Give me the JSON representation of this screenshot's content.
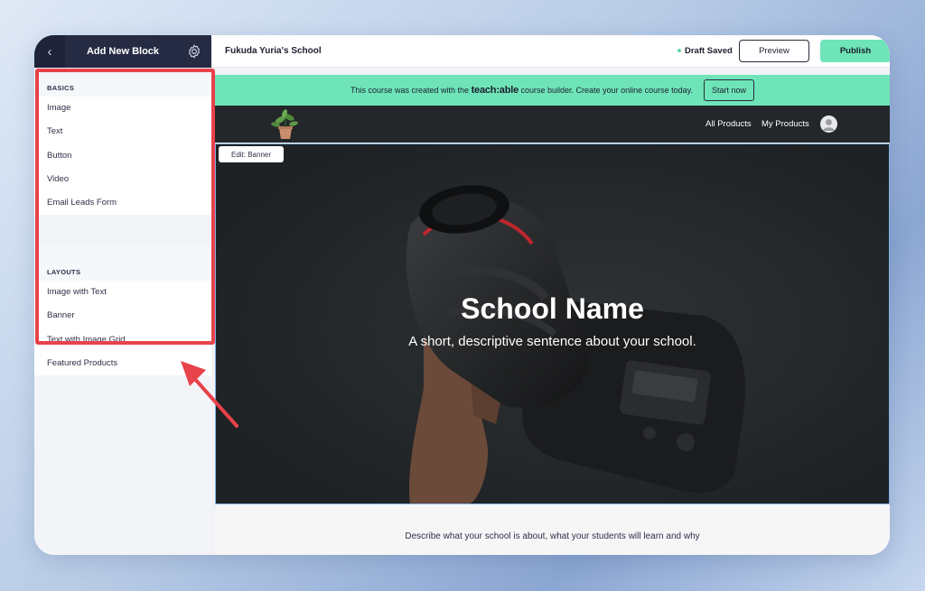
{
  "left_panel": {
    "title": "Add New Block",
    "back_icon": "chevron-left-icon",
    "settings_icon": "gear-icon",
    "basics": {
      "label": "BASICS",
      "items": [
        {
          "label": "Image"
        },
        {
          "label": "Text"
        },
        {
          "label": "Button"
        },
        {
          "label": "Video"
        },
        {
          "label": "Email Leads Form"
        }
      ]
    },
    "layouts": {
      "label": "LAYOUTS",
      "items": [
        {
          "label": "Image with Text"
        },
        {
          "label": "Banner"
        },
        {
          "label": "Text with Image Grid"
        },
        {
          "label": "Featured Products"
        }
      ]
    }
  },
  "top_bar": {
    "school_name": "Fukuda Yuria's School",
    "draft_status": "Draft Saved",
    "preview_label": "Preview",
    "publish_label": "Publish"
  },
  "promo": {
    "text_before": "This course was created with the",
    "brand": "teach:able",
    "text_after": "course builder. Create your online course today.",
    "cta_label": "Start now"
  },
  "site_nav": {
    "links": [
      {
        "label": "All Products"
      },
      {
        "label": "My Products"
      }
    ]
  },
  "banner": {
    "edit_label": "Edit: Banner",
    "title": "School Name",
    "subtitle": "A short, descriptive sentence about your school."
  },
  "content": {
    "description": "Describe what your school is about, what your students will learn and why"
  },
  "colors": {
    "panel_dark": "#262b44",
    "accent_green": "#6ee4b8",
    "highlight_red": "#e8424a",
    "banner_bg": "#232628"
  }
}
